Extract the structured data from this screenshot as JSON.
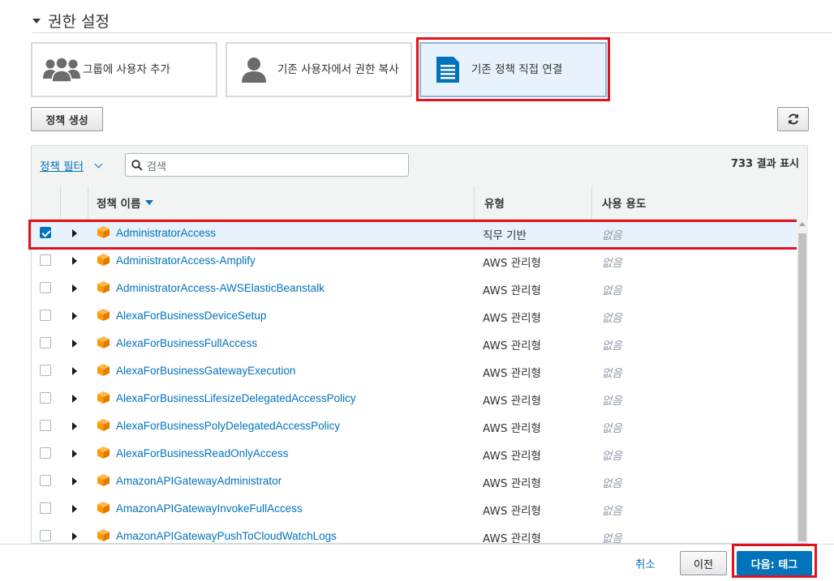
{
  "section": {
    "title": "권한 설정"
  },
  "options": [
    {
      "label": "그룹에 사용자 추가"
    },
    {
      "label": "기존 사용자에서 권한 복사"
    },
    {
      "label": "기존 정책 직접 연결"
    }
  ],
  "toolbar": {
    "create_policy": "정책 생성"
  },
  "filter": {
    "label": "정책 필터",
    "search_placeholder": "검색",
    "result_count": "733 결과 표시"
  },
  "table": {
    "columns": {
      "name": "정책 이름",
      "type": "유형",
      "usage": "사용 용도"
    },
    "rows": [
      {
        "name": "AdministratorAccess",
        "type": "직무 기반",
        "usage": "없음",
        "checked": true
      },
      {
        "name": "AdministratorAccess-Amplify",
        "type": "AWS 관리형",
        "usage": "없음"
      },
      {
        "name": "AdministratorAccess-AWSElasticBeanstalk",
        "type": "AWS 관리형",
        "usage": "없음"
      },
      {
        "name": "AlexaForBusinessDeviceSetup",
        "type": "AWS 관리형",
        "usage": "없음"
      },
      {
        "name": "AlexaForBusinessFullAccess",
        "type": "AWS 관리형",
        "usage": "없음"
      },
      {
        "name": "AlexaForBusinessGatewayExecution",
        "type": "AWS 관리형",
        "usage": "없음"
      },
      {
        "name": "AlexaForBusinessLifesizeDelegatedAccessPolicy",
        "type": "AWS 관리형",
        "usage": "없음"
      },
      {
        "name": "AlexaForBusinessPolyDelegatedAccessPolicy",
        "type": "AWS 관리형",
        "usage": "없음"
      },
      {
        "name": "AlexaForBusinessReadOnlyAccess",
        "type": "AWS 관리형",
        "usage": "없음"
      },
      {
        "name": "AmazonAPIGatewayAdministrator",
        "type": "AWS 관리형",
        "usage": "없음"
      },
      {
        "name": "AmazonAPIGatewayInvokeFullAccess",
        "type": "AWS 관리형",
        "usage": "없음"
      },
      {
        "name": "AmazonAPIGatewayPushToCloudWatchLogs",
        "type": "AWS 관리형",
        "usage": "없음"
      }
    ]
  },
  "footer": {
    "cancel": "취소",
    "previous": "이전",
    "next": "다음: 태그"
  },
  "colors": {
    "accent": "#0073bb",
    "primary_button": "#0073bb",
    "highlight": "#e1141e",
    "selected_row": "#e7f2fc",
    "policy_icon": "#f90"
  }
}
